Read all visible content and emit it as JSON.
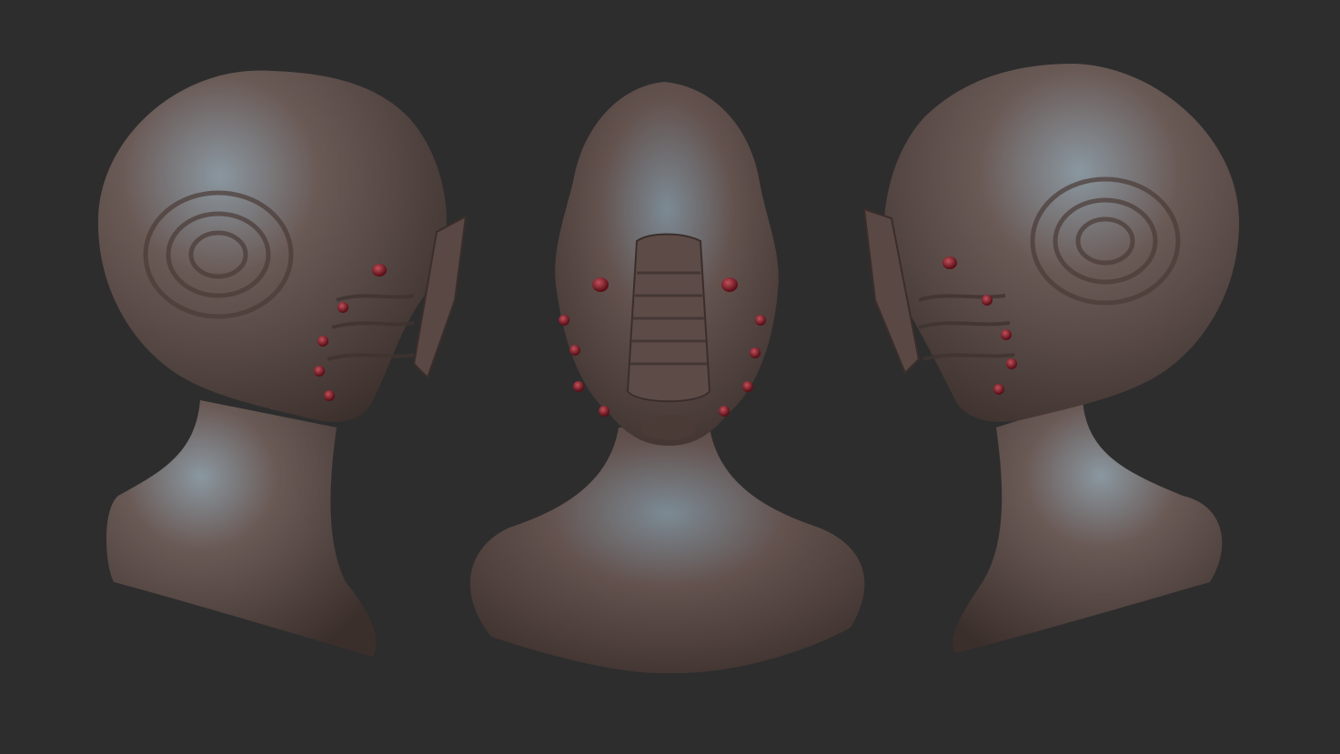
{
  "scene": {
    "background_color": "#2d2d2d",
    "skin_color": "#5e4a45",
    "skin_highlight_color": "#7e8c96",
    "skin_shadow_color": "#3a2e2b",
    "eye_color": "#8a1e2a",
    "views": [
      {
        "name": "left-profile-bust"
      },
      {
        "name": "front-bust"
      },
      {
        "name": "right-profile-bust"
      }
    ]
  }
}
